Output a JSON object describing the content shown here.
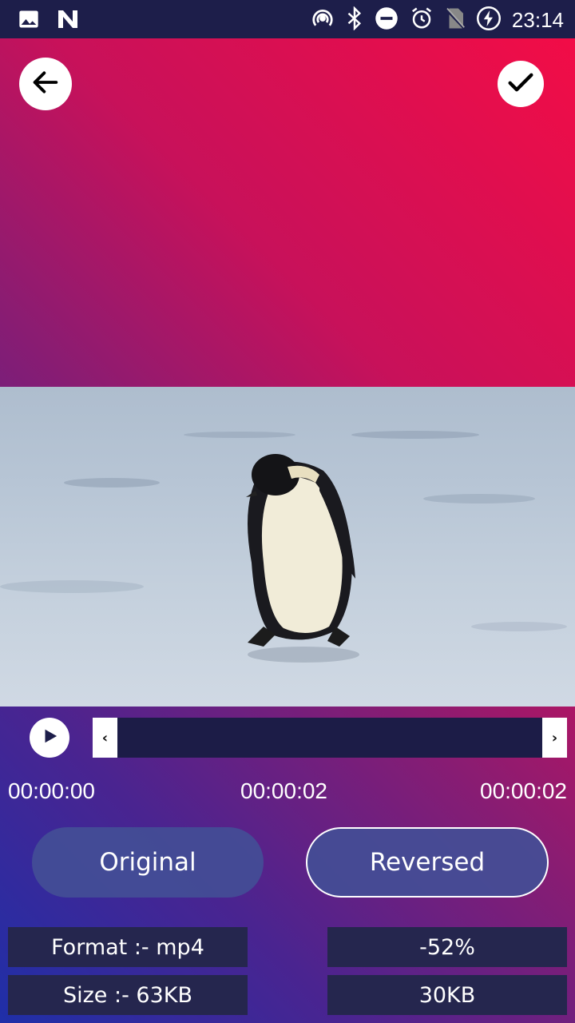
{
  "status_bar": {
    "time": "23:14",
    "icons": [
      "image-icon",
      "n-icon",
      "hotspot-icon",
      "bluetooth-icon",
      "do-not-disturb-icon",
      "alarm-icon",
      "no-sim-icon",
      "battery-charging-icon"
    ]
  },
  "toolbar": {
    "back_icon": "arrow-left-icon",
    "confirm_icon": "check-icon"
  },
  "player": {
    "play_icon": "play-icon",
    "time_start": "00:00:00",
    "time_current": "00:00:02",
    "time_end": "00:00:02",
    "left_handle": "‹",
    "right_handle": "›"
  },
  "modes": {
    "original_label": "Original",
    "reversed_label": "Reversed"
  },
  "info": {
    "format": "Format :- mp4",
    "size": "Size :- 63KB",
    "percent": "-52%",
    "new_size": "30KB"
  }
}
